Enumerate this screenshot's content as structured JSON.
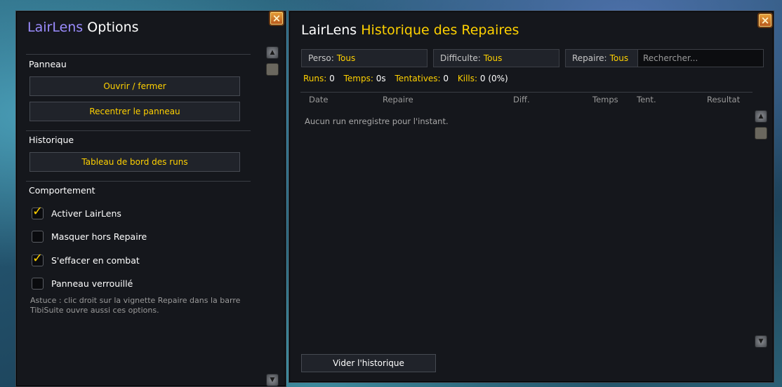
{
  "options": {
    "title_addon": "LairLens",
    "title_text": "Options",
    "close_icon": "×",
    "sections": {
      "panel": "Panneau",
      "history": "Historique",
      "behavior": "Comportement"
    },
    "buttons": {
      "toggle": "Ouvrir / fermer",
      "recenter": "Recentrer le panneau",
      "dashboard": "Tableau de bord des runs"
    },
    "checkboxes": [
      {
        "label": "Activer LairLens",
        "checked": true
      },
      {
        "label": "Masquer hors Repaire",
        "checked": false
      },
      {
        "label": "S'effacer en combat",
        "checked": true
      },
      {
        "label": "Panneau verrouillé",
        "checked": false
      }
    ],
    "hint": "Astuce : clic droit sur la vignette Repaire dans la barre TibiSuite ouvre aussi ces options."
  },
  "history": {
    "title_addon": "LairLens",
    "title_text": "Historique des Repaires",
    "close_icon": "×",
    "filters": {
      "perso_label": "Perso:",
      "perso_value": "Tous",
      "difficulty_label": "Difficulte:",
      "difficulty_value": "Tous",
      "lair_label": "Repaire:",
      "lair_value": "Tous"
    },
    "search_placeholder": "Rechercher...",
    "stats": {
      "runs_label": "Runs:",
      "runs_value": "0",
      "time_label": "Temps:",
      "time_value": "0s",
      "attempts_label": "Tentatives:",
      "attempts_value": "0",
      "kills_label": "Kills:",
      "kills_value": "0 (0%)"
    },
    "columns": [
      "Date",
      "Repaire",
      "Diff.",
      "Temps",
      "Tent.",
      "Resultat"
    ],
    "empty_message": "Aucun run enregistre pour l'instant.",
    "clear_button": "Vider l'historique"
  },
  "colors": {
    "accent_yellow": "#ffd100",
    "addon_purple": "#9b8cff",
    "panel_bg": "#15171c"
  }
}
